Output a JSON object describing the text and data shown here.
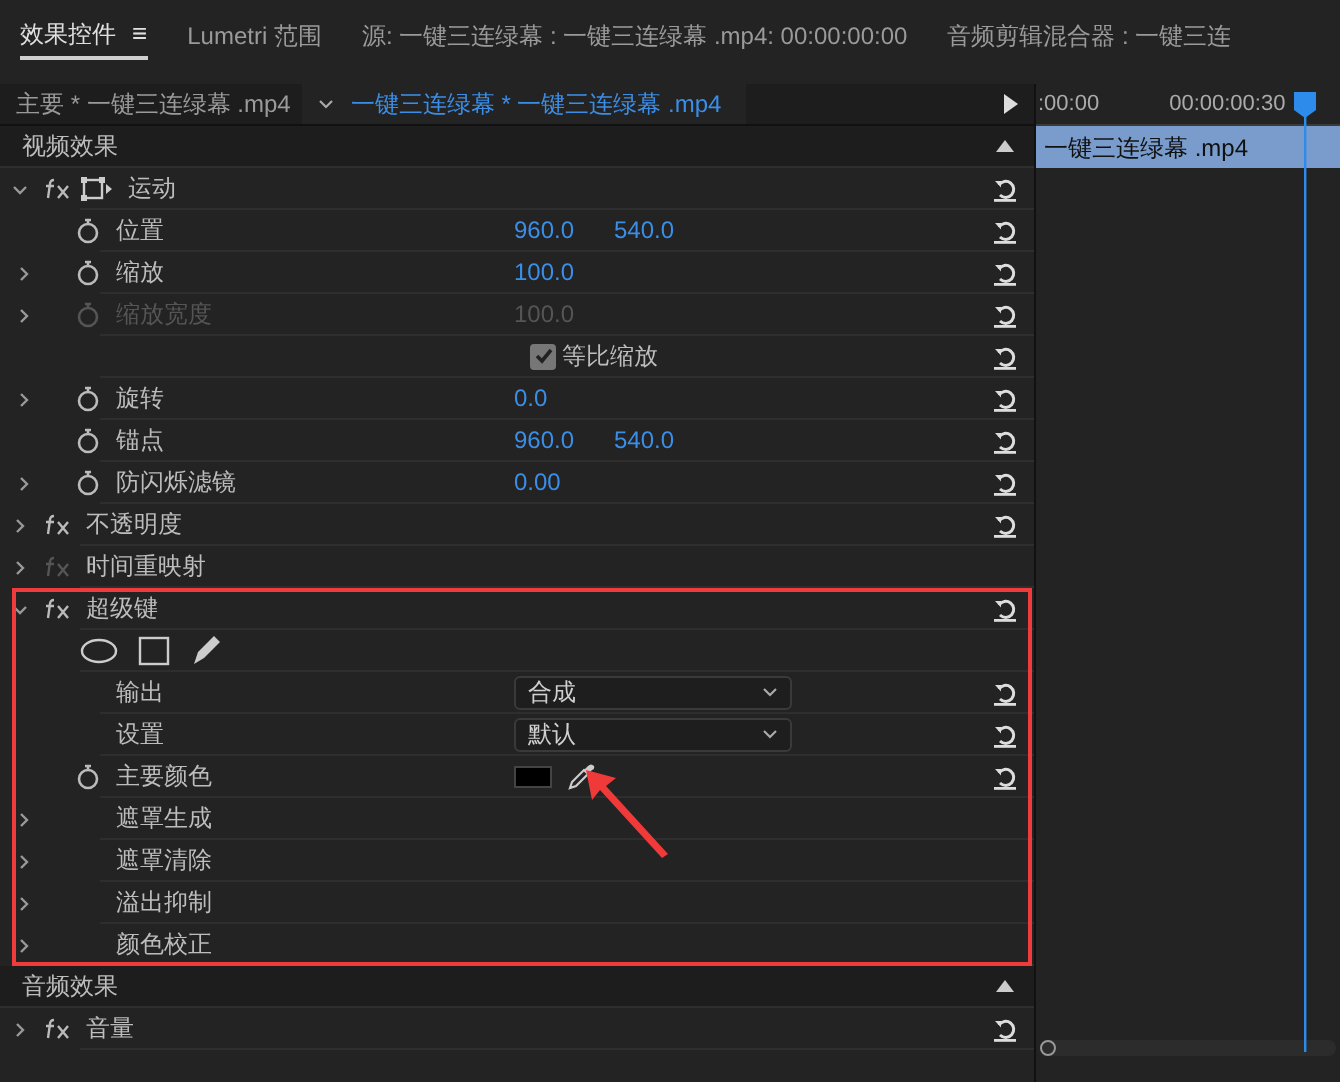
{
  "panel_tabs": [
    {
      "label": "效果控件",
      "menu": "≡",
      "selected": true
    },
    {
      "label": "Lumetri 范围",
      "selected": false
    },
    {
      "label": "源: 一键三连绿幕 : 一键三连绿幕 .mp4: 00:00:00:00",
      "selected": false
    },
    {
      "label": "音频剪辑混合器 : 一键三连",
      "selected": false
    }
  ],
  "clip_header": {
    "master": "主要 * 一键三连绿幕 .mp4",
    "current": "一键三连绿幕 * 一键三连绿幕 .mp4"
  },
  "sections": [
    {
      "title": "视频效果",
      "effects": [
        {
          "name": "运动",
          "kind": "motion",
          "expanded": true,
          "fx_active": true,
          "reset": true,
          "highlighted": false,
          "children": [
            {
              "kind": "property",
              "label": "位置",
              "expandable": false,
              "stopwatch": true,
              "disabled": false,
              "values": [
                "960.0",
                "540.0"
              ],
              "reset": true
            },
            {
              "kind": "property",
              "label": "缩放",
              "expandable": true,
              "stopwatch": true,
              "disabled": false,
              "values": [
                "100.0"
              ],
              "reset": true
            },
            {
              "kind": "property",
              "label": "缩放宽度",
              "expandable": true,
              "stopwatch": true,
              "disabled": true,
              "values": [
                "100.0"
              ],
              "reset": true
            },
            {
              "kind": "checkbox",
              "label": "等比缩放",
              "checked": true,
              "reset": true
            },
            {
              "kind": "property",
              "label": "旋转",
              "expandable": true,
              "stopwatch": true,
              "disabled": false,
              "values": [
                "0.0"
              ],
              "reset": true
            },
            {
              "kind": "property",
              "label": "锚点",
              "expandable": false,
              "stopwatch": true,
              "disabled": false,
              "values": [
                "960.0",
                "540.0"
              ],
              "reset": true
            },
            {
              "kind": "property",
              "label": "防闪烁滤镜",
              "expandable": true,
              "stopwatch": true,
              "disabled": false,
              "values": [
                "0.00"
              ],
              "reset": true
            }
          ]
        },
        {
          "name": "不透明度",
          "kind": "plain",
          "expanded": false,
          "fx_active": true,
          "reset": true,
          "highlighted": false
        },
        {
          "name": "时间重映射",
          "kind": "plain",
          "expanded": false,
          "fx_active": false,
          "reset": false,
          "highlighted": false
        },
        {
          "name": "超级键",
          "kind": "plain",
          "expanded": true,
          "fx_active": true,
          "reset": true,
          "highlighted": true,
          "children": [
            {
              "kind": "mask_tools",
              "reset": false
            },
            {
              "kind": "dropdown",
              "label": "输出",
              "value": "合成",
              "reset": true
            },
            {
              "kind": "dropdown",
              "label": "设置",
              "value": "默认",
              "reset": true
            },
            {
              "kind": "color",
              "label": "主要颜色",
              "stopwatch": true,
              "color": "#000000",
              "pointed_at": true,
              "reset": true
            },
            {
              "kind": "property",
              "label": "遮罩生成",
              "expandable": true,
              "stopwatch": false,
              "disabled": false,
              "reset": false
            },
            {
              "kind": "property",
              "label": "遮罩清除",
              "expandable": true,
              "stopwatch": false,
              "disabled": false,
              "reset": false
            },
            {
              "kind": "property",
              "label": "溢出抑制",
              "expandable": true,
              "stopwatch": false,
              "disabled": false,
              "reset": false
            },
            {
              "kind": "property",
              "label": "颜色校正",
              "expandable": true,
              "stopwatch": false,
              "disabled": false,
              "reset": false
            }
          ]
        }
      ]
    },
    {
      "title": "音频效果",
      "effects": [
        {
          "name": "音量",
          "kind": "plain",
          "expanded": false,
          "fx_active": true,
          "reset": true,
          "highlighted": false
        }
      ]
    }
  ],
  "timeline": {
    "ruler": [
      ":00:00",
      "00:00:00:30"
    ],
    "clip": "一键三连绿幕 .mp4"
  }
}
